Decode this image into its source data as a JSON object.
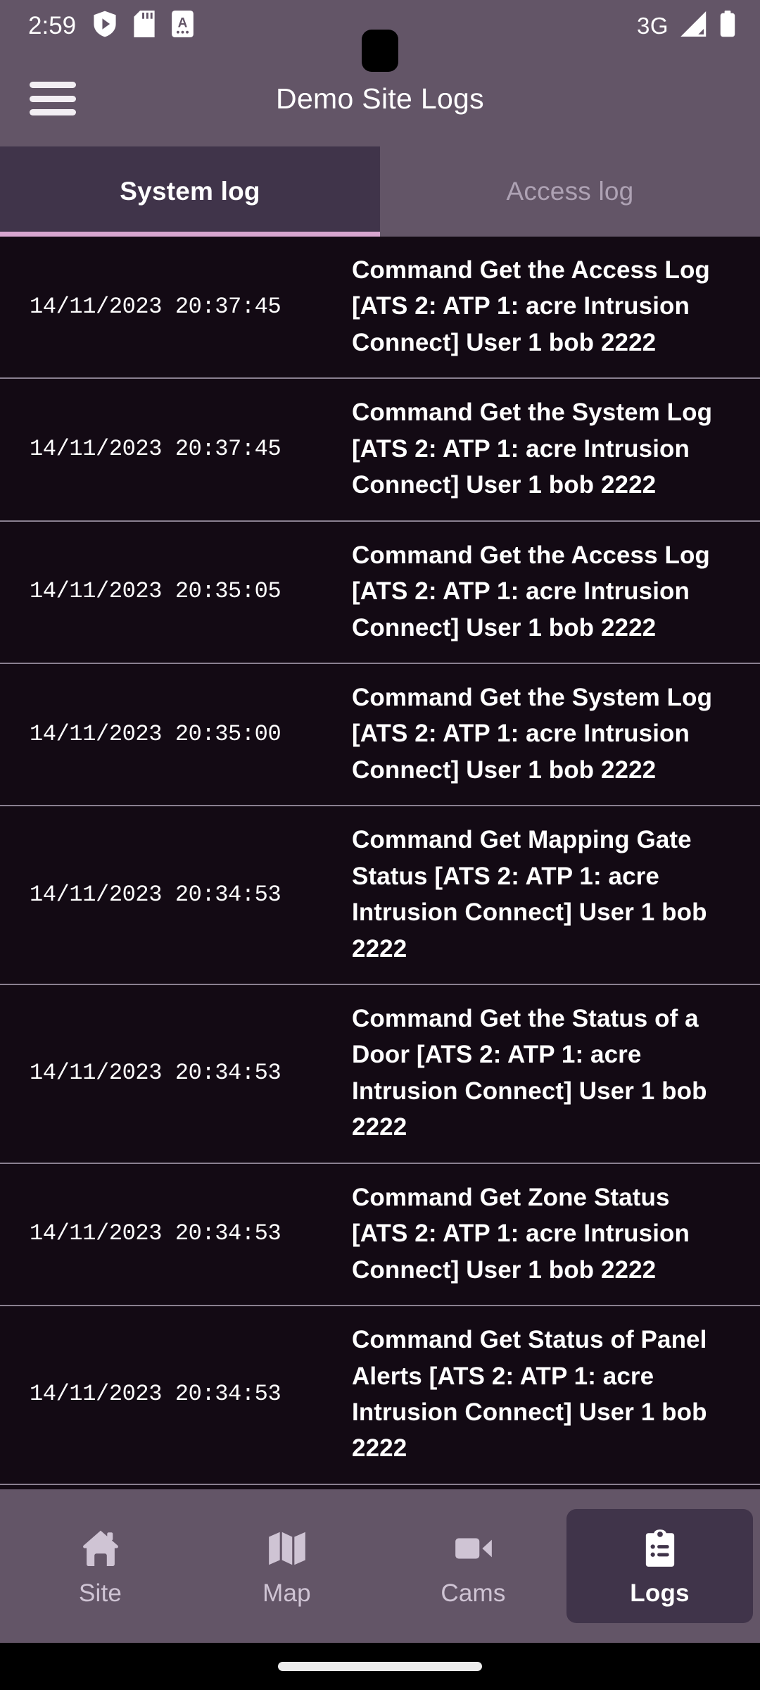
{
  "status_bar": {
    "clock": "2:59",
    "network_label": "3G",
    "icons": [
      "shield-play-icon",
      "sd-card-icon",
      "document-a-icon",
      "signal-icon",
      "battery-icon"
    ]
  },
  "app_bar": {
    "menu_icon": "hamburger-menu-icon",
    "title": "Demo Site Logs"
  },
  "tabs": [
    {
      "label": "System log",
      "active": true
    },
    {
      "label": "Access log",
      "active": false
    }
  ],
  "log_entries": [
    {
      "timestamp": "14/11/2023 20:37:45",
      "message": "Command  Get the Access Log [ATS 2: ATP 1: acre Intrusion Connect] User 1 bob 2222"
    },
    {
      "timestamp": "14/11/2023 20:37:45",
      "message": "Command  Get the System Log [ATS 2: ATP 1: acre Intrusion Connect] User 1 bob 2222"
    },
    {
      "timestamp": "14/11/2023 20:35:05",
      "message": "Command  Get the Access Log [ATS 2: ATP 1: acre Intrusion Connect] User 1 bob 2222"
    },
    {
      "timestamp": "14/11/2023 20:35:00",
      "message": "Command  Get the System Log [ATS 2: ATP 1: acre Intrusion Connect] User 1 bob 2222"
    },
    {
      "timestamp": "14/11/2023 20:34:53",
      "message": "Command  Get Mapping Gate Status [ATS 2: ATP 1: acre Intrusion Connect] User 1 bob 2222"
    },
    {
      "timestamp": "14/11/2023 20:34:53",
      "message": "Command  Get the Status of a Door [ATS 2: ATP 1: acre Intrusion Connect] User 1 bob 2222"
    },
    {
      "timestamp": "14/11/2023 20:34:53",
      "message": "Command  Get Zone Status [ATS 2: ATP 1: acre Intrusion Connect] User 1 bob 2222"
    },
    {
      "timestamp": "14/11/2023 20:34:53",
      "message": "Command  Get Status of Panel Alerts [ATS 2: ATP 1: acre Intrusion Connect] User 1 bob 2222"
    }
  ],
  "bottom_nav": [
    {
      "label": "Site",
      "icon": "home-icon",
      "active": false
    },
    {
      "label": "Map",
      "icon": "map-icon",
      "active": false
    },
    {
      "label": "Cams",
      "icon": "video-camera-icon",
      "active": false
    },
    {
      "label": "Logs",
      "icon": "clipboard-list-icon",
      "active": true
    }
  ],
  "colors": {
    "app_bar": "#635567",
    "active_tab": "#40344a",
    "tab_underline": "#d8a6d0",
    "list_background": "#130a14",
    "divider": "#8a8090",
    "text": "#ffffff",
    "muted_text": "#aea2b4"
  }
}
